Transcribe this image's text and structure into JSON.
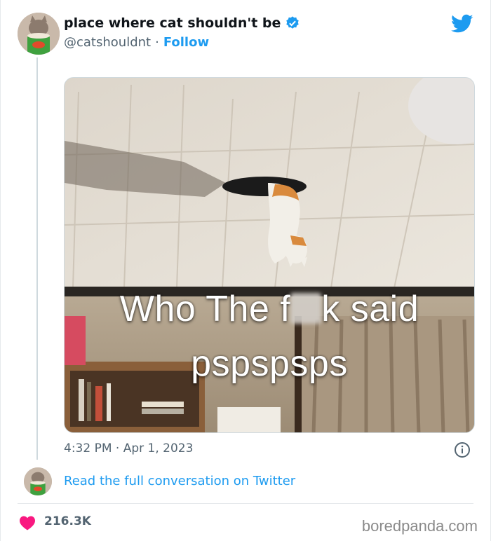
{
  "tweet": {
    "display_name": "place where cat shouldn't be",
    "handle": "@catshouldnt",
    "separator": "·",
    "follow_label": "Follow",
    "verified": true,
    "image_caption_line1_a": "Who The f",
    "image_caption_line1_b": "k said",
    "image_caption_line2": "pspspsps",
    "timestamp": "4:32 PM · Apr 1, 2023",
    "conversation_link": "Read the full conversation on Twitter",
    "like_count": "216.3K"
  },
  "footer": {
    "watermark": "boredpanda.com"
  },
  "colors": {
    "twitter_blue": "#1d9bf0",
    "like_red": "#f91880",
    "text_secondary": "#536471"
  },
  "icons": [
    "twitter-bird-icon",
    "verified-badge-icon",
    "info-icon",
    "heart-icon"
  ]
}
